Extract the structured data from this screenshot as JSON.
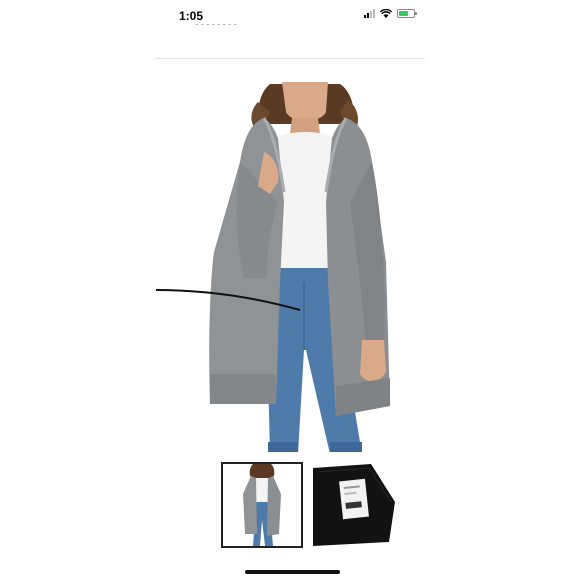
{
  "status_bar": {
    "time": "1:05"
  },
  "product": {
    "main_image_icon": "model-wearing-gray-hooded-cardigan-image",
    "thumbnails": [
      {
        "icon": "cardigan-front-thumbnail",
        "selected": true
      },
      {
        "icon": "black-fabric-with-tag-thumbnail",
        "selected": false
      }
    ]
  },
  "colors": {
    "cardigan": "#8f9396",
    "jeans": "#4f7bab",
    "top": "#ffffff",
    "hair": "#5a3a22",
    "selected_border": "#222222"
  }
}
